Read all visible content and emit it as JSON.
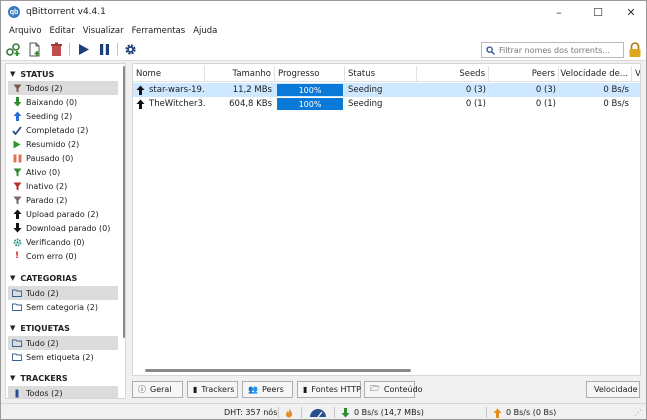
{
  "window": {
    "title": "qBittorrent v4.4.1",
    "controls": {
      "minimize": "–",
      "maximize": "☐",
      "close": "✕"
    }
  },
  "menu": [
    "Arquivo",
    "Editar",
    "Visualizar",
    "Ferramentas",
    "Ajuda"
  ],
  "toolbar": {
    "search_placeholder": "Filtrar nomes dos torrents..."
  },
  "sidebar": {
    "status": {
      "title": "STATUS",
      "items": [
        {
          "label": "Todos (2)",
          "icon": "filter-icon",
          "color": "#7a5a4a"
        },
        {
          "label": "Baixando (0)",
          "icon": "download-arrow-icon",
          "color": "#2e8b2e"
        },
        {
          "label": "Seeding (2)",
          "icon": "upload-arrow-icon",
          "color": "#2e6fd6"
        },
        {
          "label": "Completado (2)",
          "icon": "check-icon",
          "color": "#2a4d8f"
        },
        {
          "label": "Resumido (2)",
          "icon": "play-icon",
          "color": "#2e9b2e"
        },
        {
          "label": "Pausado (0)",
          "icon": "pause-icon",
          "color": "#e0705a"
        },
        {
          "label": "Ativo (0)",
          "icon": "filter-icon",
          "color": "#2e8b2e"
        },
        {
          "label": "Inativo (2)",
          "icon": "filter-icon",
          "color": "#b03030"
        },
        {
          "label": "Parado (2)",
          "icon": "filter-icon",
          "color": "#7a6a6a"
        },
        {
          "label": "Upload parado (2)",
          "icon": "up-arrow-icon",
          "color": "#111111"
        },
        {
          "label": "Download parado (0)",
          "icon": "down-arrow-icon",
          "color": "#111111"
        },
        {
          "label": "Verificando (0)",
          "icon": "gear-icon",
          "color": "#2a8f8f"
        },
        {
          "label": "Com erro (0)",
          "icon": "exclamation-icon",
          "color": "#e02020"
        }
      ]
    },
    "categories": {
      "title": "CATEGORIAS",
      "items": [
        {
          "label": "Tudo (2)",
          "icon": "folder-icon"
        },
        {
          "label": "Sem categoria (2)",
          "icon": "folder-icon"
        }
      ]
    },
    "tags": {
      "title": "ETIQUETAS",
      "items": [
        {
          "label": "Tudo (2)",
          "icon": "folder-icon"
        },
        {
          "label": "Sem etiqueta (2)",
          "icon": "folder-icon"
        }
      ]
    },
    "trackers": {
      "title": "TRACKERS",
      "items": [
        {
          "label": "Todos (2)",
          "icon": "tracker-icon"
        }
      ]
    }
  },
  "table": {
    "columns": [
      "Nome",
      "Tamanho",
      "Progresso",
      "Status",
      "Seeds",
      "Peers",
      "Velocidade de...",
      "V"
    ],
    "rows": [
      {
        "name": "star-wars-19...",
        "size": "11,2 MBs",
        "progress": "100%",
        "progress_value": 1.0,
        "status": "Seeding",
        "seeds": "0 (3)",
        "peers": "0 (3)",
        "speed": "0 Bs/s"
      },
      {
        "name": "TheWitcher3...",
        "size": "604,8 KBs",
        "progress": "100%",
        "progress_value": 1.0,
        "status": "Seeding",
        "seeds": "0 (1)",
        "peers": "0 (1)",
        "speed": "0 Bs/s"
      }
    ]
  },
  "tabs": [
    "Geral",
    "Trackers",
    "Peers",
    "Fontes HTTP",
    "Conteúdo"
  ],
  "speed_button": "Velocidade",
  "statusbar": {
    "dht": "DHT: 357 nós",
    "download": "0 Bs/s (14,7 MBs)",
    "upload": "0 Bs/s (0 Bs)"
  },
  "colors": {
    "accent": "#0a79d8",
    "selection": "#cde8ff"
  }
}
